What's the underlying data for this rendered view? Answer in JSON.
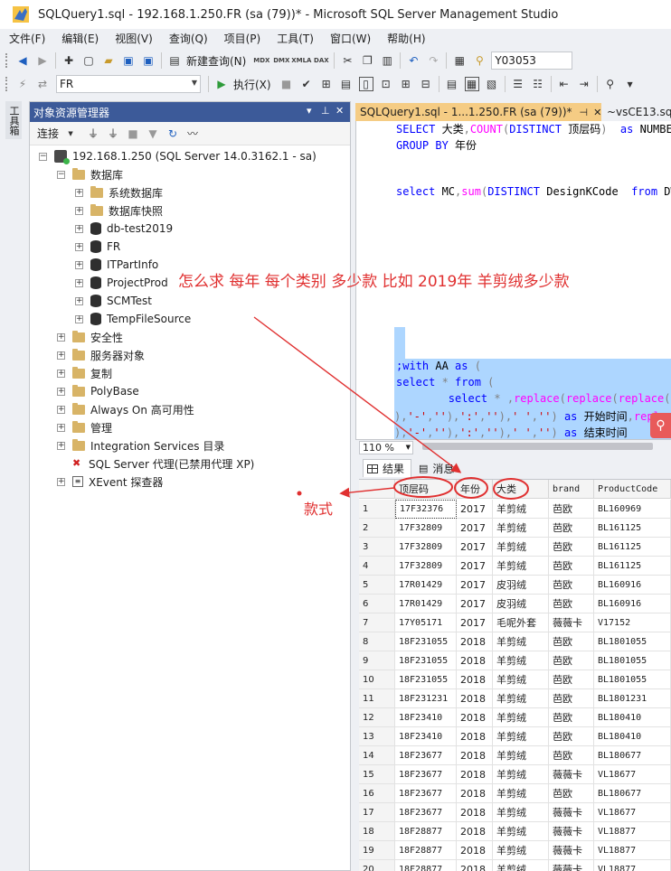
{
  "window": {
    "title": "SQLQuery1.sql - 192.168.1.250.FR (sa (79))* - Microsoft SQL Server Management Studio"
  },
  "menu": [
    "文件(F)",
    "编辑(E)",
    "视图(V)",
    "查询(Q)",
    "项目(P)",
    "工具(T)",
    "窗口(W)",
    "帮助(H)"
  ],
  "toolbar1": {
    "new_query_label": "新建查询(N)",
    "small_labels": [
      "MDX",
      "DMX",
      "XMLA",
      "DAX"
    ],
    "search_value": "Y03053"
  },
  "toolbar2": {
    "database_value": "FR",
    "execute_label": "执行(X)"
  },
  "toolbox": {
    "label": "工具箱"
  },
  "object_explorer": {
    "title": "对象资源管理器",
    "connect_label": "连接",
    "tree": [
      {
        "label": "192.168.1.250 (SQL Server 14.0.3162.1 - sa)",
        "level": 0,
        "icon": "server-icon",
        "expander": "−"
      },
      {
        "label": "数据库",
        "level": 1,
        "icon": "folder-icon",
        "expander": "−"
      },
      {
        "label": "系统数据库",
        "level": 2,
        "icon": "folder-icon",
        "expander": "+"
      },
      {
        "label": "数据库快照",
        "level": 2,
        "icon": "folder-icon",
        "expander": "+"
      },
      {
        "label": "db-test2019",
        "level": 2,
        "icon": "database-icon",
        "expander": "+"
      },
      {
        "label": "FR",
        "level": 2,
        "icon": "database-icon",
        "expander": "+"
      },
      {
        "label": "ITPartInfo",
        "level": 2,
        "icon": "database-icon",
        "expander": "+"
      },
      {
        "label": "ProjectProd",
        "level": 2,
        "icon": "database-icon",
        "expander": "+"
      },
      {
        "label": "SCMTest",
        "level": 2,
        "icon": "database-icon",
        "expander": "+"
      },
      {
        "label": "TempFileSource",
        "level": 2,
        "icon": "database-icon",
        "expander": "+"
      },
      {
        "label": "安全性",
        "level": 1,
        "icon": "folder-icon",
        "expander": "+"
      },
      {
        "label": "服务器对象",
        "level": 1,
        "icon": "folder-icon",
        "expander": "+"
      },
      {
        "label": "复制",
        "level": 1,
        "icon": "folder-icon",
        "expander": "+"
      },
      {
        "label": "PolyBase",
        "level": 1,
        "icon": "folder-icon",
        "expander": "+"
      },
      {
        "label": "Always On 高可用性",
        "level": 1,
        "icon": "folder-icon",
        "expander": "+"
      },
      {
        "label": "管理",
        "level": 1,
        "icon": "folder-icon",
        "expander": "+"
      },
      {
        "label": "Integration Services 目录",
        "level": 1,
        "icon": "folder-icon",
        "expander": "+"
      },
      {
        "label": "SQL Server 代理(已禁用代理 XP)",
        "level": 1,
        "icon": "agent-icon",
        "expander": ""
      },
      {
        "label": "XEvent 探查器",
        "level": 1,
        "icon": "xevent-icon",
        "expander": "+"
      }
    ]
  },
  "editor": {
    "tabs": [
      {
        "label": "SQLQuery1.sql - 1...1.250.FR (sa (79))*",
        "active": true
      },
      {
        "label": "~vsCE13.sql",
        "active": false
      }
    ],
    "lines": [
      {
        "segments": [
          [
            "kw",
            "SELECT "
          ],
          [
            "plain",
            "大类"
          ],
          [
            "op",
            ","
          ],
          [
            "fn",
            "COUNT"
          ],
          [
            "op",
            "("
          ],
          [
            "kw",
            "DISTINCT "
          ],
          [
            "plain",
            "顶层码"
          ],
          [
            "op",
            ")"
          ],
          [
            "plain",
            "  "
          ],
          [
            "kw",
            "as "
          ],
          [
            "plain",
            "NUMBE"
          ]
        ]
      },
      {
        "segments": [
          [
            "kw",
            "GROUP BY "
          ],
          [
            "plain",
            "年份"
          ]
        ]
      },
      {
        "segments": []
      },
      {
        "segments": [
          [
            "kw",
            "select "
          ],
          [
            "plain",
            "MC"
          ],
          [
            "op",
            ","
          ],
          [
            "fn",
            "sum"
          ],
          [
            "op",
            "("
          ],
          [
            "kw",
            "DISTINCT "
          ],
          [
            "plain",
            "DesignKCode  "
          ],
          [
            "kw",
            "from "
          ],
          [
            "plain",
            "DW"
          ]
        ]
      },
      {
        "segments": [
          [
            "kw",
            ";with "
          ],
          [
            "plain",
            "AA "
          ],
          [
            "kw",
            "as "
          ],
          [
            "op",
            "("
          ]
        ]
      },
      {
        "segments": [
          [
            "kw",
            "select "
          ],
          [
            "op",
            "* "
          ],
          [
            "kw",
            "from "
          ],
          [
            "op",
            "("
          ]
        ]
      },
      {
        "segments": [
          [
            "plain",
            "        "
          ],
          [
            "kw",
            "select "
          ],
          [
            "op",
            "* ,"
          ],
          [
            "fn",
            "replace"
          ],
          [
            "op",
            "("
          ],
          [
            "fn",
            "replace"
          ],
          [
            "op",
            "("
          ],
          [
            "fn",
            "replace"
          ],
          [
            "op",
            "("
          ],
          [
            "plain",
            "c"
          ]
        ]
      },
      {
        "segments": [
          [
            "op",
            "),"
          ],
          [
            "str",
            "'-'"
          ],
          [
            "op",
            ","
          ],
          [
            "str",
            "''"
          ],
          [
            "op",
            "),"
          ],
          [
            "str",
            "':'"
          ],
          [
            "op",
            ","
          ],
          [
            "str",
            "''"
          ],
          [
            "op",
            "),"
          ],
          [
            "str",
            "' '"
          ],
          [
            "op",
            ","
          ],
          [
            "str",
            "''"
          ],
          [
            "op",
            ") "
          ],
          [
            "kw",
            "as "
          ],
          [
            "plain",
            "开始时间"
          ],
          [
            "op",
            ","
          ],
          [
            "fn",
            "repla"
          ]
        ]
      },
      {
        "segments": [
          [
            "op",
            "),"
          ],
          [
            "str",
            "'-'"
          ],
          [
            "op",
            ","
          ],
          [
            "str",
            "''"
          ],
          [
            "op",
            "),"
          ],
          [
            "str",
            "':'"
          ],
          [
            "op",
            ","
          ],
          [
            "str",
            "''"
          ],
          [
            "op",
            "),"
          ],
          [
            "str",
            "' '"
          ],
          [
            "op",
            ","
          ],
          [
            "str",
            "''"
          ],
          [
            "op",
            ") "
          ],
          [
            "kw",
            "as "
          ],
          [
            "plain",
            "结束时间"
          ]
        ]
      }
    ],
    "zoom": "110 %"
  },
  "results": {
    "tabs": {
      "results_label": "结果",
      "messages_label": "消息"
    },
    "columns": [
      "顶层码",
      "年份",
      "大类",
      "brand",
      "ProductCode"
    ],
    "rows": [
      [
        "1",
        "17F32376",
        "2017",
        "羊剪绒",
        "芭欧",
        "BL160969"
      ],
      [
        "2",
        "17F32809",
        "2017",
        "羊剪绒",
        "芭欧",
        "BL161125"
      ],
      [
        "3",
        "17F32809",
        "2017",
        "羊剪绒",
        "芭欧",
        "BL161125"
      ],
      [
        "4",
        "17F32809",
        "2017",
        "羊剪绒",
        "芭欧",
        "BL161125"
      ],
      [
        "5",
        "17R01429",
        "2017",
        "皮羽绒",
        "芭欧",
        "BL160916"
      ],
      [
        "6",
        "17R01429",
        "2017",
        "皮羽绒",
        "芭欧",
        "BL160916"
      ],
      [
        "7",
        "17Y05171",
        "2017",
        "毛呢外套",
        "薇薇卡",
        "V17152"
      ],
      [
        "8",
        "18F231055",
        "2018",
        "羊剪绒",
        "芭欧",
        "BL1801055"
      ],
      [
        "9",
        "18F231055",
        "2018",
        "羊剪绒",
        "芭欧",
        "BL1801055"
      ],
      [
        "10",
        "18F231055",
        "2018",
        "羊剪绒",
        "芭欧",
        "BL1801055"
      ],
      [
        "11",
        "18F231231",
        "2018",
        "羊剪绒",
        "芭欧",
        "BL1801231"
      ],
      [
        "12",
        "18F23410",
        "2018",
        "羊剪绒",
        "芭欧",
        "BL180410"
      ],
      [
        "13",
        "18F23410",
        "2018",
        "羊剪绒",
        "芭欧",
        "BL180410"
      ],
      [
        "14",
        "18F23677",
        "2018",
        "羊剪绒",
        "芭欧",
        "BL180677"
      ],
      [
        "15",
        "18F23677",
        "2018",
        "羊剪绒",
        "薇薇卡",
        "VL18677"
      ],
      [
        "16",
        "18F23677",
        "2018",
        "羊剪绒",
        "芭欧",
        "BL180677"
      ],
      [
        "17",
        "18F23677",
        "2018",
        "羊剪绒",
        "薇薇卡",
        "VL18677"
      ],
      [
        "18",
        "18F28877",
        "2018",
        "羊剪绒",
        "薇薇卡",
        "VL18877"
      ],
      [
        "19",
        "18F28877",
        "2018",
        "羊剪绒",
        "薇薇卡",
        "VL18877"
      ],
      [
        "20",
        "18F28877",
        "2018",
        "羊剪绒",
        "薇薇卡",
        "VL18877"
      ]
    ]
  },
  "annotations": {
    "question": "怎么求  每年   每个类别  多少款      比如 2019年  羊剪绒多少款",
    "style_label": "款式",
    "color": "#e03030"
  }
}
